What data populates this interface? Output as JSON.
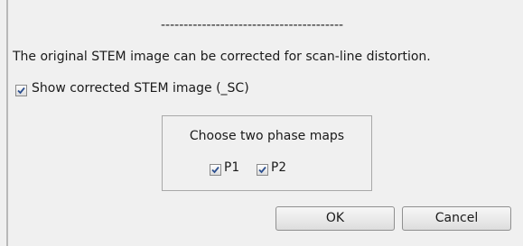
{
  "dialog": {
    "separator": "----------------------------------------",
    "description": "The original STEM image can be corrected for scan-line distortion.",
    "show_corrected": {
      "label": "Show corrected STEM image (_SC)",
      "checked": true
    },
    "phase_maps": {
      "title": "Choose two phase maps",
      "options": [
        {
          "label": "P1",
          "checked": true
        },
        {
          "label": "P2",
          "checked": true
        }
      ]
    },
    "buttons": {
      "ok": "OK",
      "cancel": "Cancel"
    }
  },
  "colors": {
    "background": "#f0f0f0",
    "checkmark": "#2c4f8f"
  }
}
